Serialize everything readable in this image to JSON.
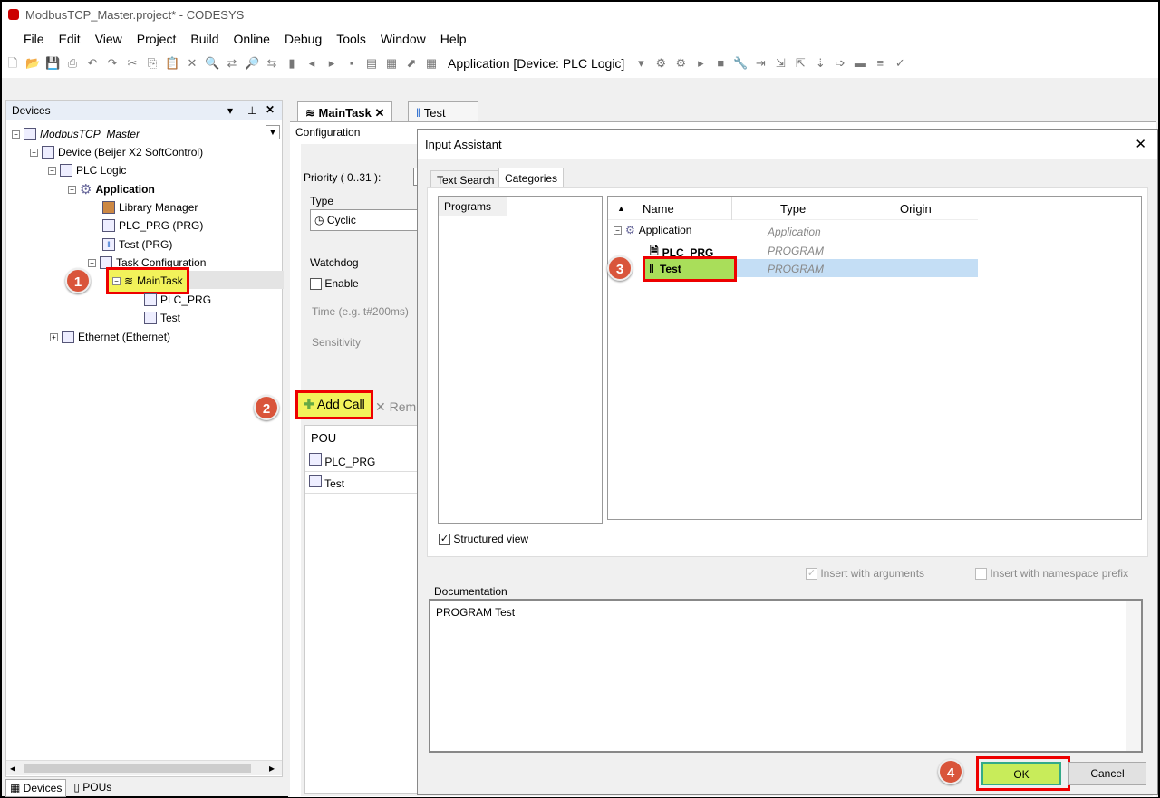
{
  "window": {
    "title": "ModbusTCP_Master.project* - CODESYS"
  },
  "menu": [
    "File",
    "Edit",
    "View",
    "Project",
    "Build",
    "Online",
    "Debug",
    "Tools",
    "Window",
    "Help"
  ],
  "toolbar": {
    "app_selector": "Application [Device: PLC Logic]"
  },
  "devices": {
    "title": "Devices",
    "tree": [
      {
        "label": "ModbusTCP_Master"
      },
      {
        "label": "Device (Beijer X2 SoftControl)"
      },
      {
        "label": "PLC Logic"
      },
      {
        "label": "Application"
      },
      {
        "label": "Library Manager"
      },
      {
        "label": "PLC_PRG (PRG)"
      },
      {
        "label": "Test (PRG)"
      },
      {
        "label": "Task Configuration"
      },
      {
        "label": "MainTask"
      },
      {
        "label": "PLC_PRG"
      },
      {
        "label": "Test"
      },
      {
        "label": "Ethernet (Ethernet)"
      }
    ],
    "bottom_tabs": [
      "Devices",
      "POUs"
    ]
  },
  "editor": {
    "tabs": [
      "MainTask",
      "Test"
    ],
    "subtab": "Configuration",
    "priority_label": "Priority ( 0..31  ):",
    "type_label": "Type",
    "type_value": "Cyclic",
    "watchdog_label": "Watchdog",
    "enable_label": "Enable",
    "time_label": "Time (e.g. t#200ms)",
    "sensitivity_label": "Sensitivity",
    "add_call": "Add Call",
    "remove": "Rem",
    "pou_header": "POU",
    "pous": [
      "PLC_PRG",
      "Test"
    ]
  },
  "dialog": {
    "title": "Input Assistant",
    "tabs": [
      "Text Search",
      "Categories"
    ],
    "categories": [
      "Programs"
    ],
    "columns": [
      "Name",
      "Type",
      "Origin"
    ],
    "rows": [
      {
        "name": "Application",
        "type": "Application"
      },
      {
        "name": "PLC_PRG",
        "type": "PROGRAM"
      },
      {
        "name": "Test",
        "type": "PROGRAM"
      }
    ],
    "structured_view": "Structured view",
    "insert_args": "Insert with arguments",
    "insert_ns": "Insert with namespace prefix",
    "doc_label": "Documentation",
    "doc_text": "PROGRAM Test",
    "ok": "OK",
    "cancel": "Cancel"
  },
  "annotations": [
    "1",
    "2",
    "3",
    "4"
  ],
  "colors": {
    "highlight": "#f2f25a",
    "annotation_border": "#e00000",
    "badge": "#d9553b",
    "selection": "#c4def5"
  }
}
